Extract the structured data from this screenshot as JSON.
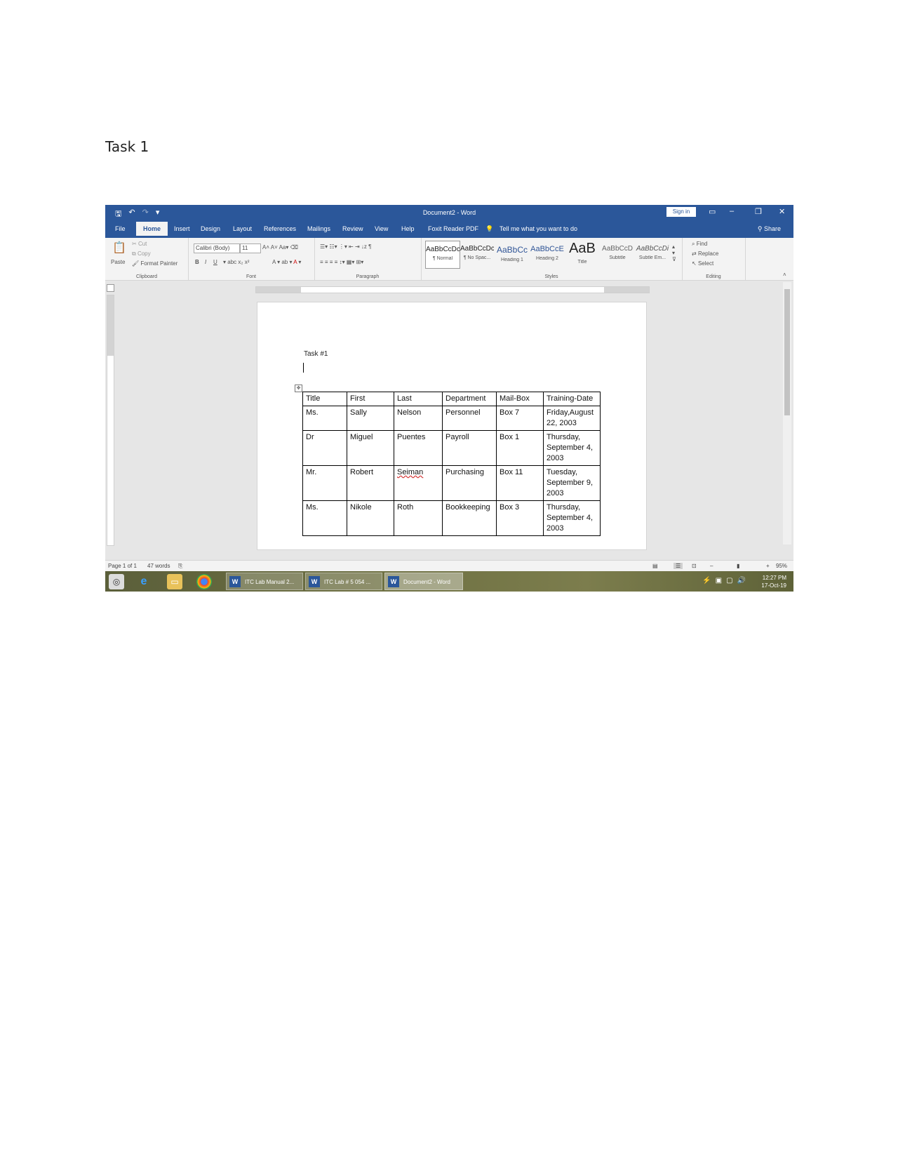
{
  "page": {
    "heading": "Task 1"
  },
  "titlebar": {
    "doc_title": "Document2 - Word",
    "signin_label": "Sign in"
  },
  "tabs": [
    "File",
    "Home",
    "Insert",
    "Design",
    "Layout",
    "References",
    "Mailings",
    "Review",
    "View",
    "Help",
    "Foxit Reader PDF"
  ],
  "tell_me": "Tell me what you want to do",
  "share_label": "Share",
  "ribbon": {
    "clipboard": {
      "paste": "Paste",
      "cut": "Cut",
      "copy": "Copy",
      "format_painter": "Format Painter",
      "label": "Clipboard"
    },
    "font": {
      "name": "Calibri (Body)",
      "size": "11",
      "label": "Font"
    },
    "paragraph": {
      "label": "Paragraph"
    },
    "styles": {
      "label": "Styles",
      "items": [
        {
          "preview": "AaBbCcDc",
          "name": "¶ Normal"
        },
        {
          "preview": "AaBbCcDc",
          "name": "¶ No Spac..."
        },
        {
          "preview": "AaBbCc",
          "name": "Heading 1"
        },
        {
          "preview": "AaBbCcE",
          "name": "Heading 2"
        },
        {
          "preview": "AaB",
          "name": "Title"
        },
        {
          "preview": "AaBbCcD",
          "name": "Subtitle"
        },
        {
          "preview": "AaBbCcDi",
          "name": "Subtle Em..."
        }
      ]
    },
    "editing": {
      "find": "Find",
      "replace": "Replace",
      "select": "Select",
      "label": "Editing"
    }
  },
  "document": {
    "task_label": "Task #1",
    "table": {
      "headers": [
        "Title",
        "First",
        "Last",
        "Department",
        "Mail-Box",
        "Training-Date"
      ],
      "rows": [
        [
          "Ms.",
          "Sally",
          "Nelson",
          "Personnel",
          "Box 7",
          "Friday,August 22, 2003"
        ],
        [
          "Dr",
          "Miguel",
          "Puentes",
          "Payroll",
          "Box 1",
          "Thursday, September 4, 2003"
        ],
        [
          "Mr.",
          "Robert",
          "Seiman",
          "Purchasing",
          "Box 11",
          "Tuesday, September 9, 2003"
        ],
        [
          "Ms.",
          "Nikole",
          "Roth",
          "Bookkeeping",
          "Box 3",
          "Thursday, September 4, 2003"
        ]
      ]
    }
  },
  "statusbar": {
    "page": "Page 1 of 1",
    "words": "47 words",
    "zoom": "95%"
  },
  "taskbar": {
    "buttons": [
      {
        "label": "ITC Lab Manual 2..."
      },
      {
        "label": "ITC Lab # 5 054 ..."
      },
      {
        "label": "Document2 - Word"
      }
    ],
    "time": "12:27 PM",
    "date": "17-Oct-19"
  }
}
